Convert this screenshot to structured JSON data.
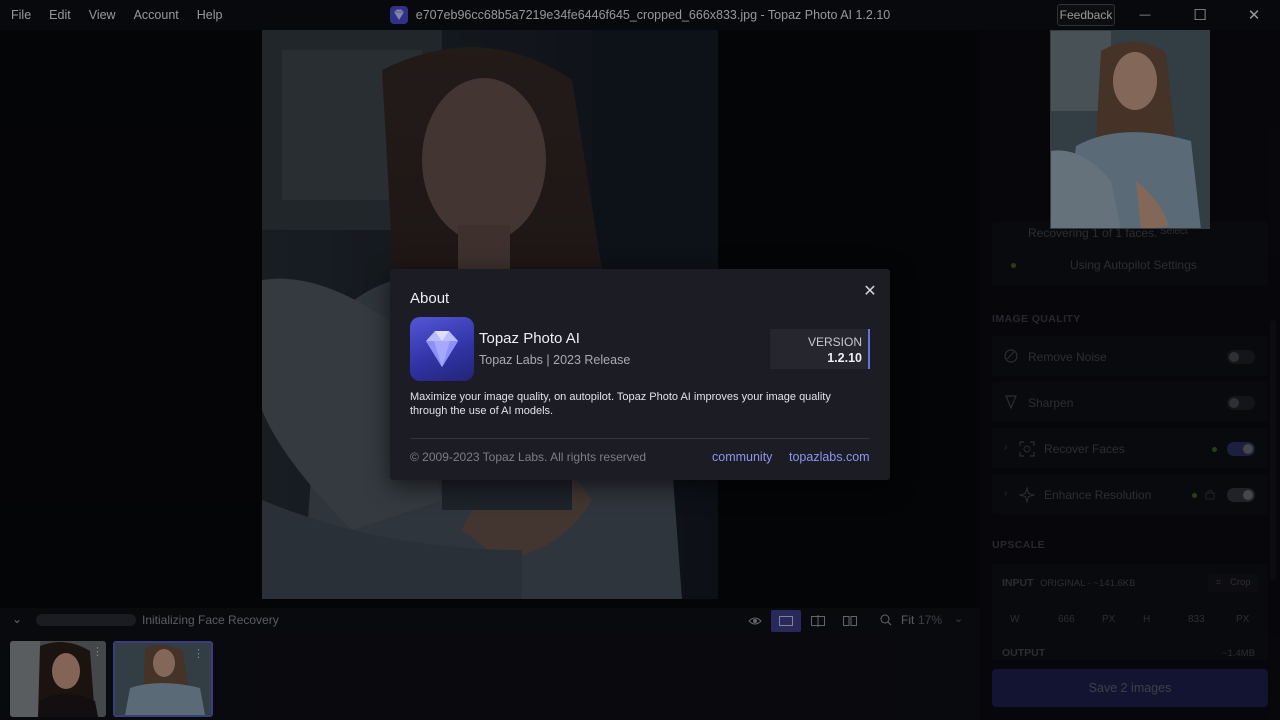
{
  "menu": {
    "items": [
      "File",
      "Edit",
      "View",
      "Account",
      "Help"
    ]
  },
  "window": {
    "title": "e707eb96cc68b5a7219e34fe6446f645_cropped_666x833.jpg - Topaz Photo AI 1.2.10",
    "feedback_label": "Feedback",
    "minimize_glyph": "—",
    "maximize_glyph": "☐",
    "close_glyph": "✕"
  },
  "right_panel": {
    "recovering_text": "Recovering 1 of 1 faces.",
    "select_label": "Select",
    "autopilot_text": "Using Autopilot Settings",
    "image_quality_title": "IMAGE QUALITY",
    "remove_noise_label": "Remove Noise",
    "sharpen_label": "Sharpen",
    "recover_faces_label": "Recover Faces",
    "enhance_resolution_label": "Enhance Resolution",
    "upscale_title": "UPSCALE",
    "input_label": "INPUT",
    "input_detail": "ORIGINAL · ~141.6KB",
    "crop_label": "Crop",
    "dims_w": "W",
    "dims_w_val": "666",
    "dims_unit": "PX",
    "dims_h": "H",
    "dims_h_val": "833",
    "output_label": "OUTPUT",
    "output_size": "~1.4MB",
    "save_label": "Save 2 images",
    "toggles": {
      "remove_noise": false,
      "sharpen": false,
      "recover_faces": true,
      "enhance_resolution": true
    }
  },
  "bottom_bar": {
    "status_text": "Initializing Face Recovery",
    "zoom_label": "Fit",
    "zoom_value": "17%"
  },
  "about_dialog": {
    "title": "About",
    "app_name": "Topaz Photo AI",
    "app_subtitle": "Topaz Labs | 2023 Release",
    "version_label": "VERSION",
    "version_number": "1.2.10",
    "description": "Maximize your image quality, on autopilot. Topaz Photo AI improves your image quality through the use of AI models.",
    "copyright": "© 2009-2023 Topaz Labs. All rights reserved",
    "link_community": "community",
    "link_website": "topazlabs.com",
    "close_glyph": "✕"
  },
  "colors": {
    "accent": "#5b5fc7",
    "link": "#8f93f0",
    "background": "#0d0e13",
    "dialog": "#1c1d24"
  }
}
